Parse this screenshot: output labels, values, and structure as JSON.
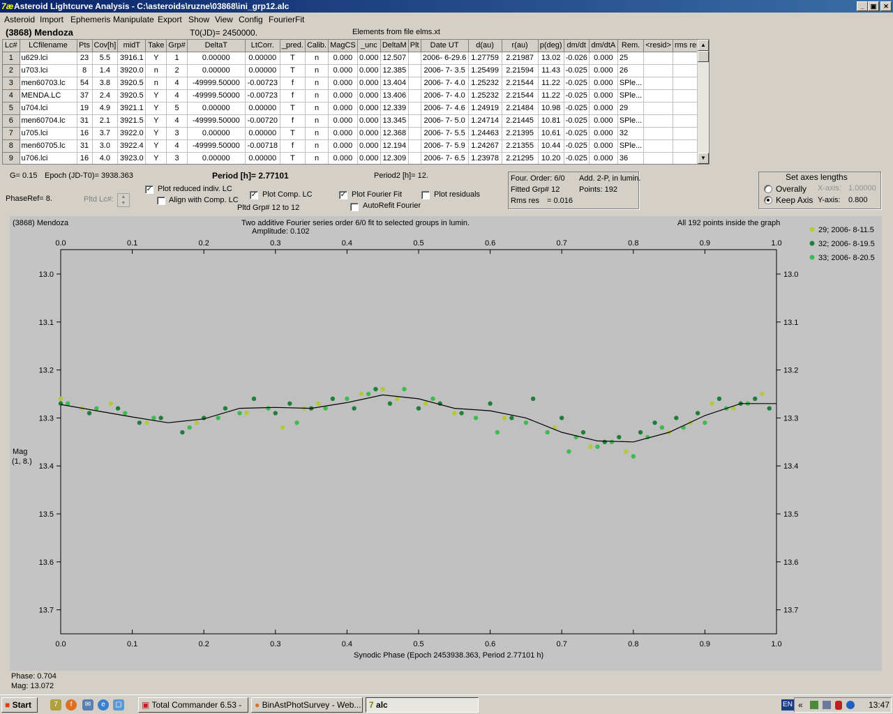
{
  "window": {
    "title": "Asteroid Lightcurve Analysis - C:\\asteroids\\ruzne\\03868\\ini_grp12.alc",
    "icon_glyph": "7æ"
  },
  "menu": [
    "Asteroid",
    "Import",
    "Ephemeris",
    "Manipulate",
    "Export",
    "Show",
    "View",
    "Config",
    "FourierFit"
  ],
  "header": {
    "asteroid": "(3868) Mendoza",
    "t0": "T0(JD)= 2450000.",
    "elements": "Elements from file elms.xt"
  },
  "table": {
    "columns": [
      "Lc#",
      "LCfilename",
      "Pts",
      "Cov[h]",
      "midT",
      "Take",
      "Grp#",
      "DeltaT",
      "LtCorr.",
      "_pred.",
      "Calib.",
      "MagCS",
      "_unc",
      "DeltaM",
      "Plt",
      "Date UT",
      "d(au)",
      "r(au)",
      "p(deg)",
      "dm/dt",
      "dm/dtA",
      "Rem.",
      "<resid>",
      "rms res"
    ],
    "rows": [
      [
        "1",
        "u629.lci",
        "23",
        "5.5",
        "3916.1",
        "Y",
        "1",
        "0.00000",
        "0.00000",
        "T",
        "n",
        "0.000",
        "0.000",
        "12.507",
        "",
        "2006- 6-29.6",
        "1.27759",
        "2.21987",
        "13.02",
        "-0.026",
        "0.000",
        "25",
        "",
        ""
      ],
      [
        "2",
        "u703.lci",
        "8",
        "1.4",
        "3920.0",
        "n",
        "2",
        "0.00000",
        "0.00000",
        "T",
        "n",
        "0.000",
        "0.000",
        "12.385",
        "",
        "2006- 7- 3.5",
        "1.25499",
        "2.21594",
        "11.43",
        "-0.025",
        "0.000",
        "26",
        "",
        ""
      ],
      [
        "3",
        "men60703.lc",
        "54",
        "3.8",
        "3920.5",
        "n",
        "4",
        "-49999.50000",
        "-0.00723",
        "f",
        "n",
        "0.000",
        "0.000",
        "13.404",
        "",
        "2006- 7- 4.0",
        "1.25232",
        "2.21544",
        "11.22",
        "-0.025",
        "0.000",
        "SPle...",
        "",
        ""
      ],
      [
        "4",
        "MENDA.LC",
        "37",
        "2.4",
        "3920.5",
        "Y",
        "4",
        "-49999.50000",
        "-0.00723",
        "f",
        "n",
        "0.000",
        "0.000",
        "13.406",
        "",
        "2006- 7- 4.0",
        "1.25232",
        "2.21544",
        "11.22",
        "-0.025",
        "0.000",
        "SPle...",
        "",
        ""
      ],
      [
        "5",
        "u704.lci",
        "19",
        "4.9",
        "3921.1",
        "Y",
        "5",
        "0.00000",
        "0.00000",
        "T",
        "n",
        "0.000",
        "0.000",
        "12.339",
        "",
        "2006- 7- 4.6",
        "1.24919",
        "2.21484",
        "10.98",
        "-0.025",
        "0.000",
        "29",
        "",
        ""
      ],
      [
        "6",
        "men60704.lc",
        "31",
        "2.1",
        "3921.5",
        "Y",
        "4",
        "-49999.50000",
        "-0.00720",
        "f",
        "n",
        "0.000",
        "0.000",
        "13.345",
        "",
        "2006- 7- 5.0",
        "1.24714",
        "2.21445",
        "10.81",
        "-0.025",
        "0.000",
        "SPle...",
        "",
        ""
      ],
      [
        "7",
        "u705.lci",
        "16",
        "3.7",
        "3922.0",
        "Y",
        "3",
        "0.00000",
        "0.00000",
        "T",
        "n",
        "0.000",
        "0.000",
        "12.368",
        "",
        "2006- 7- 5.5",
        "1.24463",
        "2.21395",
        "10.61",
        "-0.025",
        "0.000",
        "32",
        "",
        ""
      ],
      [
        "8",
        "men60705.lc",
        "31",
        "3.0",
        "3922.4",
        "Y",
        "4",
        "-49999.50000",
        "-0.00718",
        "f",
        "n",
        "0.000",
        "0.000",
        "12.194",
        "",
        "2006- 7- 5.9",
        "1.24267",
        "2.21355",
        "10.44",
        "-0.025",
        "0.000",
        "SPle...",
        "",
        ""
      ],
      [
        "9",
        "u706.lci",
        "16",
        "4.0",
        "3923.0",
        "Y",
        "3",
        "0.00000",
        "0.00000",
        "T",
        "n",
        "0.000",
        "0.000",
        "12.309",
        "",
        "2006- 7- 6.5",
        "1.23978",
        "2.21295",
        "10.20",
        "-0.025",
        "0.000",
        "36",
        "",
        ""
      ]
    ]
  },
  "controls": {
    "g": "G= 0.15",
    "epoch": "Epoch (JD-T0)= 3938.363",
    "period": "Period [h]= 2.77101",
    "period2": "Period2 [h]= 12.",
    "phaseref": "PhaseRef= 8.",
    "pltd_lc": "Pltd Lc#:",
    "plot_reduced": "Plot reduced indiv. LC",
    "align_comp": "Align with Comp. LC",
    "plot_comp": "Plot Comp. LC",
    "pltd_grp": "Pltd Grp#  12 to   12",
    "plot_fourier": "Plot Fourier Fit",
    "autorefit": "AutoRefit Fourier",
    "plot_residuals": "Plot residuals"
  },
  "fourier": {
    "order": "Four. Order:  6/0",
    "add": "Add. 2-P, in lumin.",
    "fitted": "Fitted Grp# 12",
    "points": "Points: 192",
    "rms": "Rms res",
    "rms_val": "= 0.016"
  },
  "axes_box": {
    "title": "Set axes lengths",
    "overall": "Overally",
    "keep": "Keep Axis",
    "xaxis_label": "X-axis:",
    "xaxis_val": "1.00000",
    "yaxis_label": "Y-axis:",
    "yaxis_val": "0.800"
  },
  "chart_data": {
    "type": "scatter",
    "title": "(3868) Mendoza",
    "subtitle": "Two additive Fourier series order 6/0 fit to selected groups in lumin.",
    "amplitude": "Amplitude: 0.102",
    "note": "All 192 points inside the graph",
    "xlabel": "Synodic Phase (Epoch 2453938.363, Period 2.77101 h)",
    "ylabel": "Mag",
    "ylabel2": "(1, 8.)",
    "xlim": [
      0.0,
      1.0
    ],
    "ylim": [
      13.0,
      13.8
    ],
    "y_inverted": true,
    "xticks": [
      "0.0",
      "0.1",
      "0.2",
      "0.3",
      "0.4",
      "0.5",
      "0.6",
      "0.7",
      "0.8",
      "0.9",
      "1.0"
    ],
    "yticks": [
      "13.0",
      "13.1",
      "13.2",
      "13.3",
      "13.4",
      "13.5",
      "13.6",
      "13.7"
    ],
    "fit_curve": {
      "x": [
        0.0,
        0.05,
        0.1,
        0.15,
        0.2,
        0.25,
        0.3,
        0.35,
        0.4,
        0.45,
        0.5,
        0.55,
        0.6,
        0.65,
        0.7,
        0.75,
        0.8,
        0.85,
        0.9,
        0.95,
        1.0
      ],
      "y": [
        13.272,
        13.285,
        13.298,
        13.31,
        13.302,
        13.28,
        13.278,
        13.28,
        13.268,
        13.252,
        13.26,
        13.28,
        13.285,
        13.3,
        13.33,
        13.348,
        13.35,
        13.33,
        13.295,
        13.27,
        13.27
      ]
    },
    "series": [
      {
        "name": "29; 2006- 8-11.5",
        "color": "#b3c93a",
        "x": [
          0.0,
          0.03,
          0.07,
          0.12,
          0.19,
          0.26,
          0.31,
          0.34,
          0.36,
          0.42,
          0.45,
          0.47,
          0.51,
          0.55,
          0.62,
          0.69,
          0.74,
          0.79,
          0.85,
          0.88,
          0.91,
          0.94,
          0.98
        ],
        "y": [
          13.26,
          13.28,
          13.27,
          13.31,
          13.31,
          13.29,
          13.32,
          13.28,
          13.27,
          13.25,
          13.24,
          13.26,
          13.27,
          13.29,
          13.3,
          13.32,
          13.36,
          13.37,
          13.33,
          13.31,
          13.27,
          13.28,
          13.25
        ]
      },
      {
        "name": "32; 2006- 8-19.5",
        "color": "#1f7e3a",
        "x": [
          0.0,
          0.04,
          0.08,
          0.11,
          0.14,
          0.17,
          0.2,
          0.23,
          0.27,
          0.3,
          0.32,
          0.35,
          0.38,
          0.41,
          0.44,
          0.46,
          0.5,
          0.53,
          0.56,
          0.6,
          0.63,
          0.66,
          0.7,
          0.73,
          0.76,
          0.78,
          0.81,
          0.83,
          0.86,
          0.89,
          0.92,
          0.95,
          0.97,
          0.99
        ],
        "y": [
          13.27,
          13.29,
          13.28,
          13.31,
          13.3,
          13.33,
          13.3,
          13.28,
          13.26,
          13.29,
          13.27,
          13.28,
          13.26,
          13.28,
          13.24,
          13.27,
          13.28,
          13.27,
          13.29,
          13.27,
          13.3,
          13.26,
          13.3,
          13.33,
          13.35,
          13.34,
          13.33,
          13.31,
          13.3,
          13.29,
          13.26,
          13.27,
          13.26,
          13.28
        ]
      },
      {
        "name": "33; 2006- 8-20.5",
        "color": "#3dbb4e",
        "x": [
          0.01,
          0.05,
          0.09,
          0.13,
          0.18,
          0.22,
          0.25,
          0.29,
          0.33,
          0.37,
          0.4,
          0.43,
          0.48,
          0.52,
          0.58,
          0.61,
          0.65,
          0.68,
          0.71,
          0.72,
          0.75,
          0.77,
          0.8,
          0.82,
          0.84,
          0.87,
          0.9,
          0.93,
          0.96
        ],
        "y": [
          13.27,
          13.28,
          13.29,
          13.3,
          13.32,
          13.3,
          13.29,
          13.28,
          13.31,
          13.28,
          13.26,
          13.25,
          13.24,
          13.26,
          13.3,
          13.33,
          13.31,
          13.33,
          13.37,
          13.34,
          13.36,
          13.35,
          13.38,
          13.34,
          13.32,
          13.32,
          13.31,
          13.28,
          13.27
        ]
      }
    ]
  },
  "status": {
    "phase": "Phase:  0.704",
    "mag": "Mag:    13.072"
  },
  "taskbar": {
    "start": "Start",
    "tasks": [
      "Total Commander 6.53 - ...",
      "BinAstPhotSurvey - Web...",
      "alc"
    ],
    "lang": "EN",
    "tray_arrows": "«",
    "clock": "13:47"
  }
}
